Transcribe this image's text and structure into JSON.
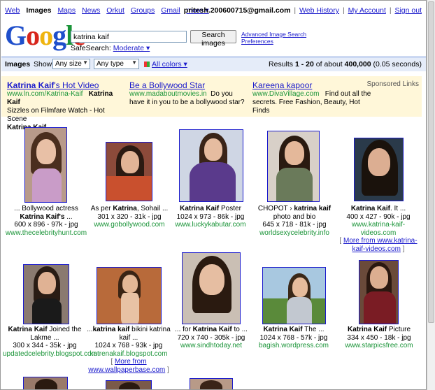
{
  "topnav": {
    "items": [
      "Web",
      "Images",
      "Maps",
      "News",
      "Orkut",
      "Groups",
      "Gmail",
      "more ▾"
    ],
    "current_index": 1
  },
  "user": {
    "email": "pritesh.200600715@gmail.com",
    "links": [
      "Web History",
      "My Account",
      "Sign out"
    ]
  },
  "search": {
    "query": "katrina kaif",
    "button": "Search images",
    "advanced": "Advanced Image Search",
    "preferences": "Preferences",
    "safesearch_label": "SafeSearch:",
    "safesearch_value": "Moderate ▾"
  },
  "imagebar": {
    "title": "Images",
    "show_label": "Show:",
    "size": "Any size",
    "type": "Any type",
    "colors": "All colors ▾",
    "results_prefix": "Results",
    "results_range": "1 - 20",
    "results_of": "of about",
    "results_total": "400,000",
    "results_time": "(0.05 seconds)"
  },
  "ads": {
    "sponsored": "Sponsored Links",
    "items": [
      {
        "title_bold": "Katrina Kaif",
        "title_rest": "'s Hot Video",
        "url": "www.ln.com/Katrina-Kaif",
        "text_bold": "Katrina Kaif",
        "text": "Sizzles on Filmfare Watch - Hot Scene",
        "text_bold2": "Katrina Kaif"
      },
      {
        "title": "Be a Bollywood Star",
        "url": "www.madaboutmovies.in",
        "text": "Do you have it in you to be a bollywood star?"
      },
      {
        "title": "Kareena kapoor",
        "url": "www.DivaVillage.com",
        "text": "Find out all the secrets. Free Fashion, Beauty, Hot Finds"
      }
    ]
  },
  "results": [
    {
      "caption_html_a": "... Bollywood actress ",
      "caption_b": "Katrina Kaif's",
      "caption_c": " ...",
      "meta": "600 x 896 - 97k - jpg",
      "site": "www.thecelebrityhunt.com"
    },
    {
      "caption_html_a": "As per ",
      "caption_b": "Katrina",
      "caption_c": ", Sohail ...",
      "meta": "301 x 320 - 31k - jpg",
      "site": "www.gobollywood.com"
    },
    {
      "caption_html_a": "",
      "caption_b": "Katrina Kaif",
      "caption_c": " Poster",
      "meta": "1024 x 973 - 86k - jpg",
      "site": "www.luckykabutar.com"
    },
    {
      "caption_html_a": "CHOPOT › ",
      "caption_b": "katrina kaif",
      "caption_c": " photo and bio",
      "meta": "645 x 718 - 81k - jpg",
      "site": "worldsexycelebrity.info"
    },
    {
      "caption_html_a": "",
      "caption_b": "Katrina Kaif",
      "caption_c": ". It ...",
      "meta": "400 x 427 - 90k - jpg",
      "site": "www.katrina-kaif-videos.com",
      "more": "More from www.katrina-kaif-videos.com"
    },
    {
      "caption_html_a": "",
      "caption_b": "Katrina Kaif",
      "caption_c": " Joined the Lakme ...",
      "meta": "300 x 344 - 35k - jpg",
      "site": "updatedcelebrity.blogspot.com"
    },
    {
      "caption_html_a": "...",
      "caption_b": "katrina kaif",
      "caption_c": " bikini katrina kaif ...",
      "meta": "1024 x 768 - 93k - jpg",
      "site": "katrenakaif.blogspot.com",
      "more": "More from www.wallpaperbase.com"
    },
    {
      "caption_html_a": "... for ",
      "caption_b": "Katrina Kaif",
      "caption_c": " to ...",
      "meta": "720 x 740 - 305k - jpg",
      "site": "www.sindhtoday.net"
    },
    {
      "caption_html_a": "",
      "caption_b": "Katrina Kaif",
      "caption_c": " The ...",
      "meta": "1024 x 768 - 57k - jpg",
      "site": "bagish.wordpress.com"
    },
    {
      "caption_html_a": "",
      "caption_b": "Katrina Kaif",
      "caption_c": " Picture",
      "meta": "334 x 450 - 18k - jpg",
      "site": "www.starpicsfree.com"
    }
  ],
  "colors": {
    "link": "#1a1acc",
    "url_green": "#1a9438",
    "bar_bg": "#e5ecf9",
    "ad_bg": "#fff7d9"
  }
}
